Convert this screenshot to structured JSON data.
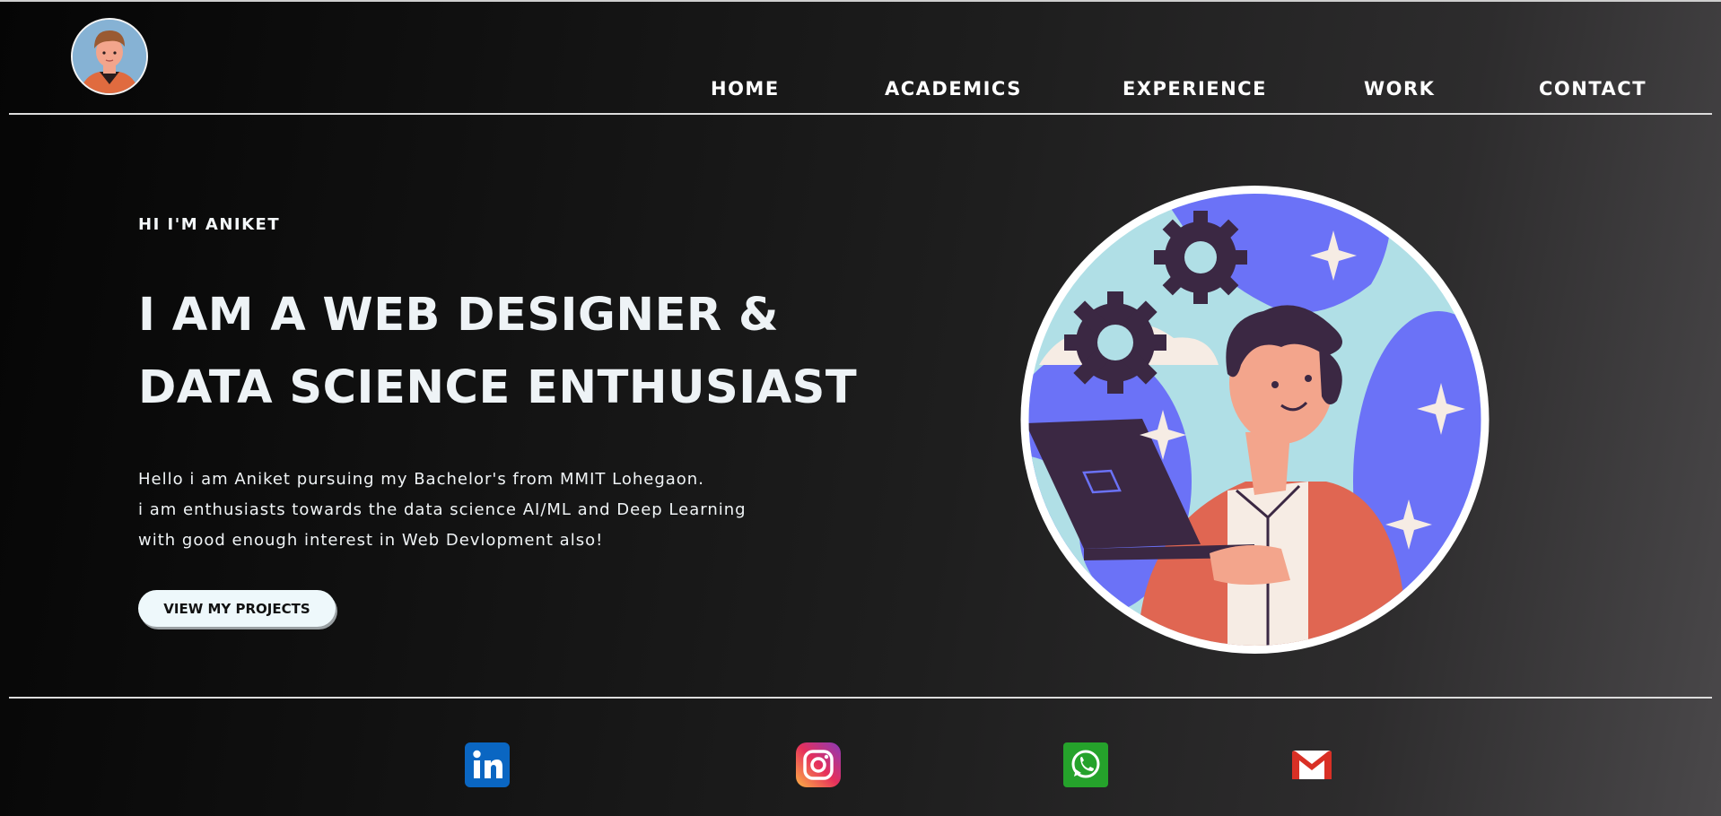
{
  "nav": {
    "items": [
      {
        "label": "HOME"
      },
      {
        "label": "ACADEMICS"
      },
      {
        "label": "EXPERIENCE"
      },
      {
        "label": "WORK"
      },
      {
        "label": "CONTACT"
      }
    ]
  },
  "hero": {
    "eyebrow": "HI I'M ANIKET",
    "headline_line1": "I AM A WEB DESIGNER &",
    "headline_line2": "DATA SCIENCE ENTHUSIAST",
    "para_line1": "Hello i am Aniket pursuing my Bachelor's from MMIT Lohegaon.",
    "para_line2": "i am enthusiasts towards the data science AI/ML and Deep Learning",
    "para_line3": "with good enough interest in Web Devlopment also!",
    "cta_label": "VIEW MY PROJECTS"
  },
  "social": [
    {
      "icon": "linkedin-icon",
      "color": "#0a66c2"
    },
    {
      "icon": "instagram-icon",
      "color": "#e1306c"
    },
    {
      "icon": "whatsapp-icon",
      "color": "#25a22b"
    },
    {
      "icon": "gmail-icon",
      "color": "#d93025"
    }
  ],
  "colors": {
    "accent_blue": "#6b72f7",
    "light_blue": "#b0dfe6",
    "orange": "#e06652",
    "dark_purple": "#3b2843"
  }
}
